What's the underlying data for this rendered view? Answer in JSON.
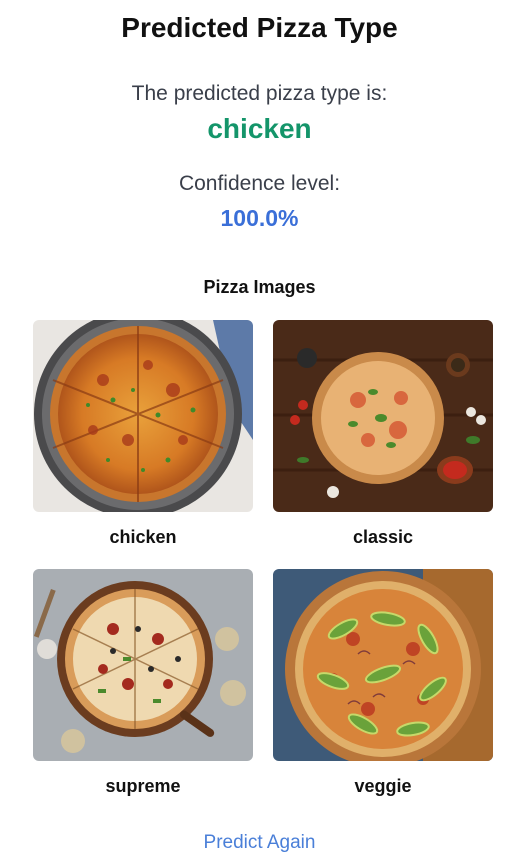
{
  "header": {
    "title": "Predicted Pizza Type"
  },
  "prediction": {
    "label": "The predicted pizza type is:",
    "value": "chicken",
    "confidence_label": "Confidence level:",
    "confidence_value": "100.0%"
  },
  "gallery": {
    "title": "Pizza Images",
    "items": [
      {
        "caption": "chicken"
      },
      {
        "caption": "classic"
      },
      {
        "caption": "supreme"
      },
      {
        "caption": "veggie"
      }
    ]
  },
  "actions": {
    "predict_again": "Predict Again"
  },
  "colors": {
    "prediction": "#14956a",
    "confidence": "#3a6fd8",
    "link": "#4a7fd8"
  }
}
